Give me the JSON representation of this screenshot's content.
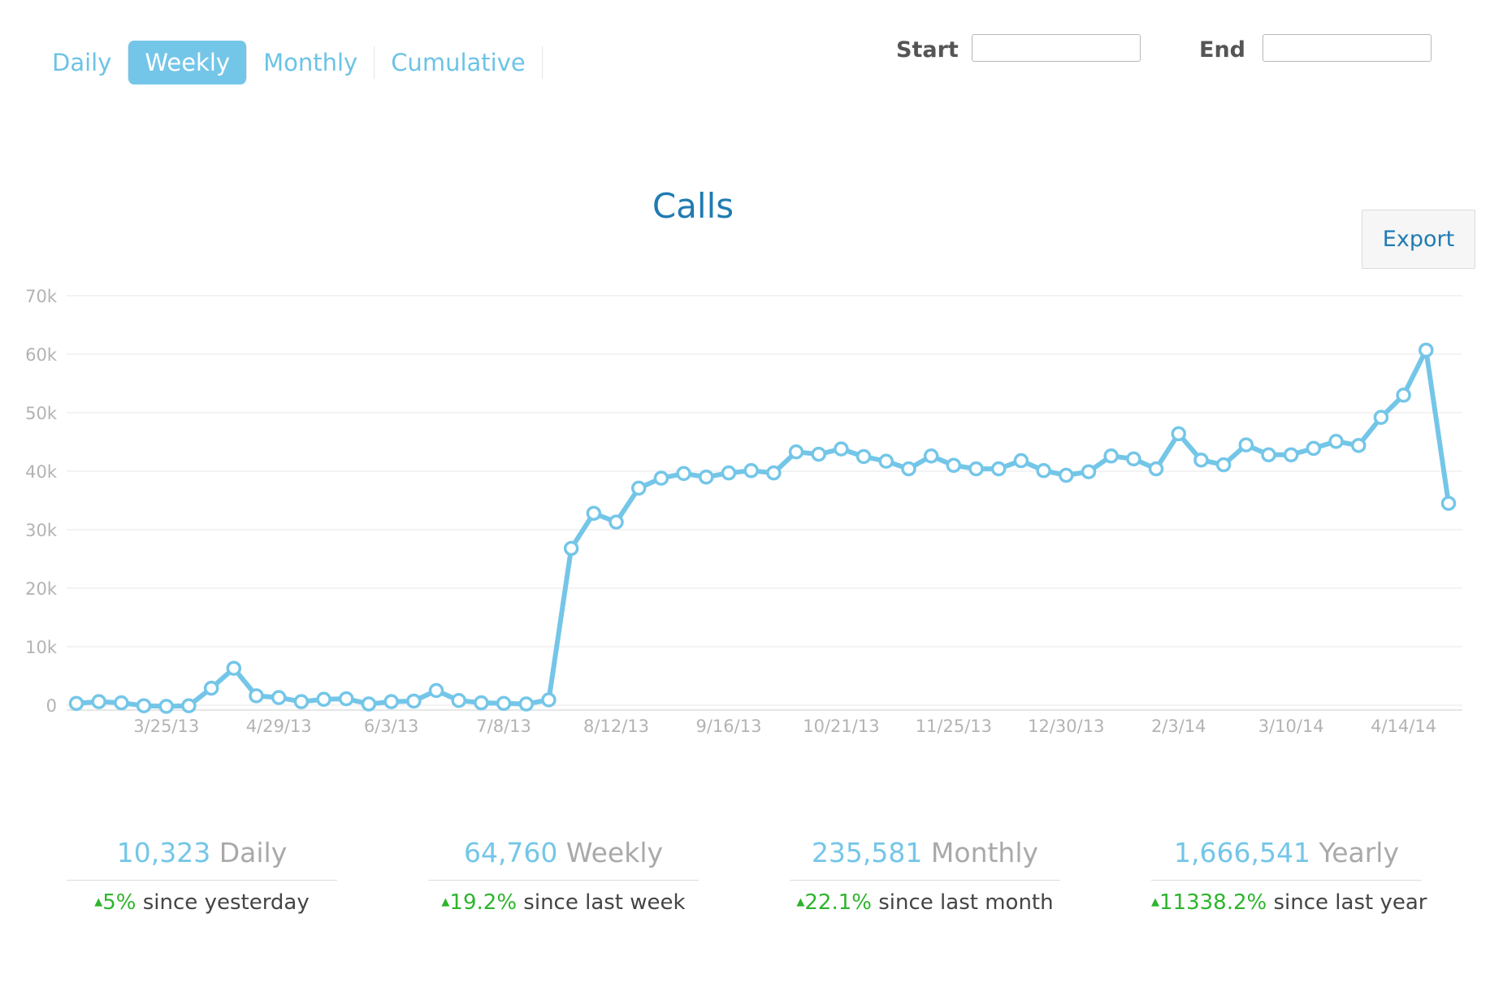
{
  "tabs": [
    {
      "label": "Daily",
      "active": false
    },
    {
      "label": "Weekly",
      "active": true
    },
    {
      "label": "Monthly",
      "active": false
    },
    {
      "label": "Cumulative",
      "active": false
    }
  ],
  "date_range": {
    "start_label": "Start",
    "end_label": "End",
    "start_value": "",
    "end_value": ""
  },
  "export_label": "Export",
  "chart_data": {
    "type": "line",
    "title": "Calls",
    "xlabel": "",
    "ylabel": "",
    "ylim": [
      0,
      70000
    ],
    "yticks": [
      0,
      10000,
      20000,
      30000,
      40000,
      50000,
      60000,
      70000
    ],
    "ytick_labels": [
      "0",
      "10k",
      "20k",
      "30k",
      "40k",
      "50k",
      "60k",
      "70k"
    ],
    "xtick_labels": [
      "3/25/13",
      "4/29/13",
      "6/3/13",
      "7/8/13",
      "8/12/13",
      "9/16/13",
      "10/21/13",
      "11/25/13",
      "12/30/13",
      "2/3/14",
      "3/10/14",
      "4/14/14"
    ],
    "xtick_indices": [
      4,
      9,
      14,
      19,
      24,
      29,
      34,
      39,
      44,
      49,
      54,
      59
    ],
    "grid": true,
    "color": "#74c6e8",
    "series": [
      {
        "values": [
          300,
          600,
          400,
          -100,
          -200,
          -100,
          2900,
          6300,
          1600,
          1300,
          600,
          1000,
          1100,
          200,
          600,
          700,
          2500,
          800,
          400,
          300,
          200,
          900,
          26800,
          32800,
          31300,
          37100,
          38800,
          39600,
          39000,
          39700,
          40100,
          39700,
          43300,
          42900,
          43800,
          42500,
          41700,
          40400,
          42600,
          41000,
          40400,
          40400,
          41800,
          40100,
          39300,
          39900,
          42600,
          42100,
          40400,
          46400,
          41900,
          41100,
          44500,
          42800,
          42800,
          43900,
          45100,
          44400,
          49200,
          53000,
          60700,
          34500
        ]
      }
    ]
  },
  "stats": [
    {
      "value": "10,323",
      "unit": "Daily",
      "change": "5%",
      "since": "since yesterday"
    },
    {
      "value": "64,760",
      "unit": "Weekly",
      "change": "19.2%",
      "since": "since last week"
    },
    {
      "value": "235,581",
      "unit": "Monthly",
      "change": "22.1%",
      "since": "since last month"
    },
    {
      "value": "1,666,541",
      "unit": "Yearly",
      "change": "11338.2%",
      "since": "since last year"
    }
  ],
  "colors": {
    "accent": "#74c6e8",
    "positive": "#2db52d",
    "title": "#1f7bb3"
  },
  "icons": {
    "change_up": "triangle-up-icon"
  }
}
